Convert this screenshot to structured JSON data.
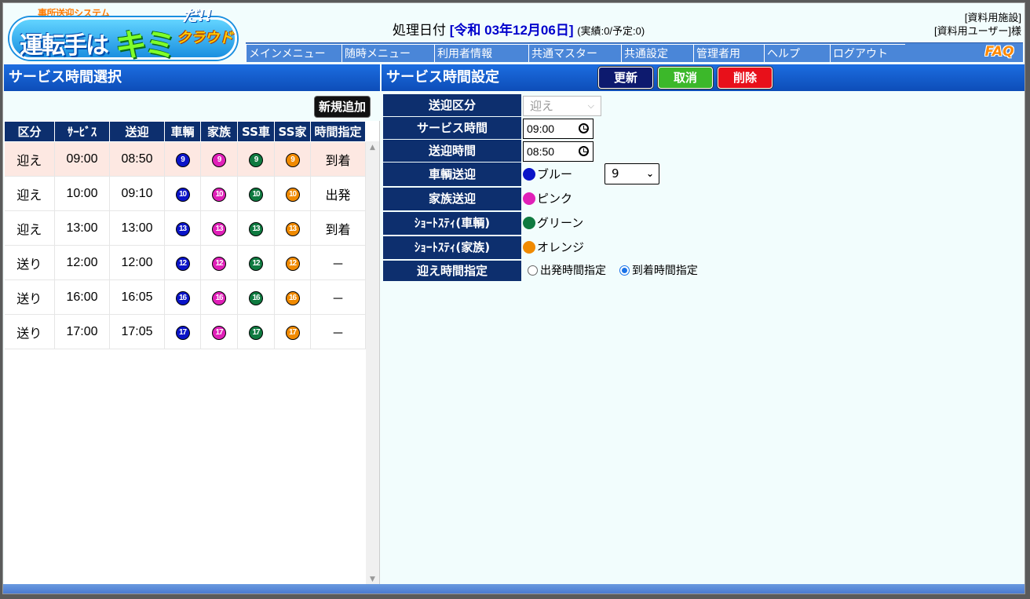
{
  "logo": {
    "sub": "事所送迎システム",
    "line1": "運転手は",
    "line2": "キミ",
    "line3": "だ!!",
    "line4": "クラウド"
  },
  "header": {
    "date_label": "処理日付",
    "date_value": "[令和 03年12月06日]",
    "status": "(実績:0/予定:0)",
    "facility": "[資料用施設]",
    "user": "[資料用ユーザー]様"
  },
  "menu": [
    {
      "label": "メインメニュー"
    },
    {
      "label": "随時メニュー"
    },
    {
      "label": "利用者情報"
    },
    {
      "label": "共通マスター"
    },
    {
      "label": "共通設定"
    },
    {
      "label": "管理者用"
    },
    {
      "label": "ヘルプ"
    },
    {
      "label": "ログアウト"
    }
  ],
  "faq_label": "FAQ",
  "left": {
    "title": "サービス時間選択",
    "new_button": "新規追加",
    "columns": [
      "区分",
      "ｻｰﾋﾞｽ",
      "送迎",
      "車輌",
      "家族",
      "SS車",
      "SS家",
      "時間指定"
    ],
    "rows": [
      {
        "kubun": "迎え",
        "service": "09:00",
        "sougei": "08:50",
        "num": "9",
        "mode": "到着",
        "selected": true
      },
      {
        "kubun": "迎え",
        "service": "10:00",
        "sougei": "09:10",
        "num": "10",
        "mode": "出発",
        "selected": false
      },
      {
        "kubun": "迎え",
        "service": "13:00",
        "sougei": "13:00",
        "num": "13",
        "mode": "到着",
        "selected": false
      },
      {
        "kubun": "送り",
        "service": "12:00",
        "sougei": "12:00",
        "num": "12",
        "mode": "－",
        "selected": false
      },
      {
        "kubun": "送り",
        "service": "16:00",
        "sougei": "16:05",
        "num": "16",
        "mode": "－",
        "selected": false
      },
      {
        "kubun": "送り",
        "service": "17:00",
        "sougei": "17:05",
        "num": "17",
        "mode": "－",
        "selected": false
      }
    ]
  },
  "right": {
    "title": "サービス時間設定",
    "buttons": {
      "update": "更新",
      "cancel": "取消",
      "delete": "削除"
    },
    "fields": {
      "kubun_label": "送迎区分",
      "kubun_value": "迎え",
      "service_time_label": "サービス時間",
      "service_time_value": "09:00",
      "pickup_time_label": "送迎時間",
      "pickup_time_value": "08:50",
      "vehicle_label": "車輌送迎",
      "vehicle_color": "ブルー",
      "vehicle_number": "9",
      "family_label": "家族送迎",
      "family_color": "ピンク",
      "ss_vehicle_label": "ｼｮｰﾄｽﾃｨ(車輌)",
      "ss_vehicle_color": "グリーン",
      "ss_family_label": "ｼｮｰﾄｽﾃｨ(家族)",
      "ss_family_color": "オレンジ",
      "time_spec_label": "迎え時間指定",
      "radio_depart": "出発時間指定",
      "radio_arrive": "到着時間指定"
    }
  },
  "colors": {
    "blue": "#0a14c8",
    "pink": "#e020b8",
    "green": "#0f7a40",
    "orange": "#f08a00",
    "header_blue": "#1c6de0",
    "label_navy": "#0d2f6e"
  }
}
